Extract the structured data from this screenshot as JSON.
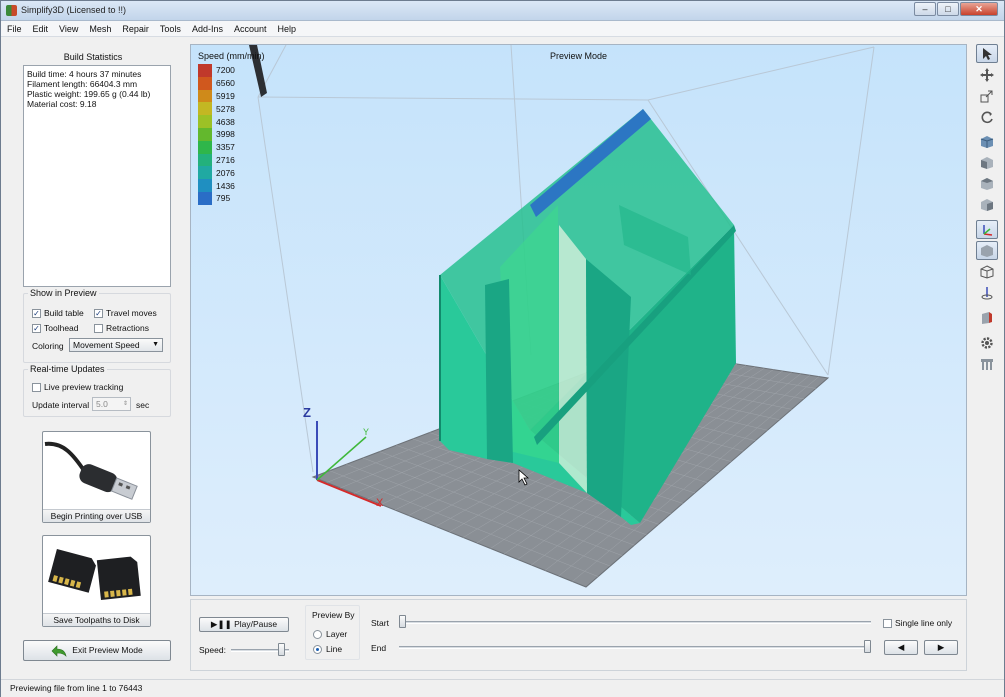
{
  "window": {
    "title": "Simplify3D (Licensed to !!)",
    "minimize": "–",
    "maximize": "□",
    "close": "✕"
  },
  "menu": [
    "File",
    "Edit",
    "View",
    "Mesh",
    "Repair",
    "Tools",
    "Add-Ins",
    "Account",
    "Help"
  ],
  "left": {
    "build_stats_title": "Build Statistics",
    "stats": [
      "Build time: 4 hours 37 minutes",
      "Filament length: 66404.3 mm",
      "Plastic weight: 199.65 g (0.44 lb)",
      "Material cost: 9.18"
    ],
    "show_in_preview": {
      "label": "Show in Preview",
      "build_table": "Build table",
      "travel_moves": "Travel moves",
      "toolhead": "Toolhead",
      "retractions": "Retractions",
      "coloring_label": "Coloring",
      "coloring_value": "Movement Speed",
      "check": "✓"
    },
    "realtime": {
      "label": "Real-time Updates",
      "live_tracking": "Live preview tracking",
      "interval_label": "Update interval",
      "interval_value": "5.0",
      "interval_unit": "sec"
    },
    "usb_button": "Begin Printing over USB",
    "sd_button": "Save Toolpaths to Disk",
    "exit_button": "Exit Preview Mode"
  },
  "viewport": {
    "mode_title": "Preview Mode",
    "legend_title": "Speed (mm/min)",
    "legend": [
      {
        "value": "7200",
        "color": "#c0392b"
      },
      {
        "value": "6560",
        "color": "#d0581e"
      },
      {
        "value": "5919",
        "color": "#cf8a1a"
      },
      {
        "value": "5278",
        "color": "#c3b723"
      },
      {
        "value": "4638",
        "color": "#9cc126"
      },
      {
        "value": "3998",
        "color": "#63b82d"
      },
      {
        "value": "3357",
        "color": "#2fb64a"
      },
      {
        "value": "2716",
        "color": "#23b17c"
      },
      {
        "value": "2076",
        "color": "#20a9a2"
      },
      {
        "value": "1436",
        "color": "#1f8fc1"
      },
      {
        "value": "795",
        "color": "#2a6dc6"
      }
    ],
    "axis_z": "Z",
    "axis_x": "X",
    "axis_y": "Y"
  },
  "bottom": {
    "play_pause": "Play/Pause",
    "speed_label": "Speed:",
    "speed_level": 0.92,
    "preview_by": "Preview By",
    "layer": "Layer",
    "line": "Line",
    "start_label": "Start",
    "end_label": "End",
    "start_value": 0.0,
    "end_value": 1.0,
    "single_line": "Single line only",
    "prev": "◀",
    "next": "▶"
  },
  "toolbar_icons": [
    "select-icon",
    "move-icon",
    "scale-icon",
    "rotate-icon",
    "view-iso-icon",
    "view-front-icon",
    "view-top-icon",
    "view-side-icon",
    "axes-icon",
    "solid-view-icon",
    "wireframe-icon",
    "center-axis-icon",
    "section-icon",
    "settings-icon",
    "supports-icon"
  ],
  "status": "Previewing file from line 1 to 76443"
}
